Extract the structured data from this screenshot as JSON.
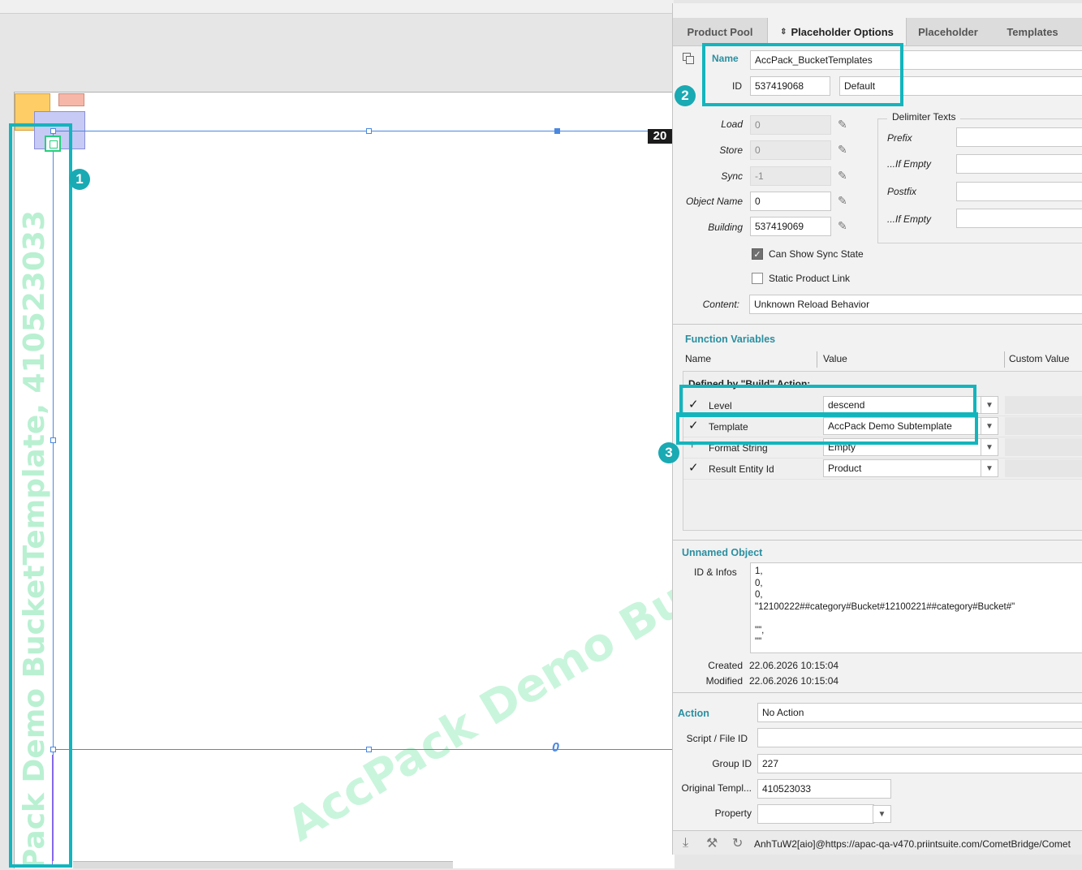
{
  "canvas": {
    "frame_counter": "20",
    "zero_marker": "0",
    "watermark_vertical": "Pack Demo BucketTemplate, 410523033",
    "watermark_diagonal": "AccPack Demo BucketT",
    "annotations": [
      "1",
      "2",
      "3"
    ]
  },
  "tabs": [
    {
      "label": "Product Pool"
    },
    {
      "label": "Placeholder Options",
      "prefix_icon": "sort-arrows-icon",
      "active": true
    },
    {
      "label": "Placeholder"
    },
    {
      "label": "Templates"
    }
  ],
  "header": {
    "name_label": "Name",
    "name_value": "AccPack_BucketTemplates",
    "id_label": "ID",
    "id_value": "537419068",
    "id_type": "Default"
  },
  "fields": {
    "load_label": "Load",
    "load_value": "0",
    "store_label": "Store",
    "store_value": "0",
    "sync_label": "Sync",
    "sync_value": "-1",
    "objname_label": "Object Name",
    "objname_value": "0",
    "building_label": "Building",
    "building_value": "537419069"
  },
  "delimiter": {
    "title": "Delimiter Texts",
    "prefix_label": "Prefix",
    "if_empty_label": "...If Empty",
    "postfix_label": "Postfix",
    "if_empty2_label": "...If Empty"
  },
  "checkboxes": {
    "sync_state_label": "Can Show Sync State",
    "sync_state_checked": true,
    "static_link_label": "Static Product Link",
    "static_link_checked": false
  },
  "content": {
    "label": "Content:",
    "value": "Unknown Reload Behavior"
  },
  "function_vars": {
    "title": "Function Variables",
    "col_name": "Name",
    "col_value": "Value",
    "col_custom": "Custom Value",
    "group_label": "Defined by \"Build\" Action:",
    "rows": [
      {
        "mark": "✓",
        "name": "Level",
        "value": "descend"
      },
      {
        "mark": "✓",
        "name": "Template",
        "value": "AccPack Demo Subtemplate"
      },
      {
        "mark": "+",
        "name": "Format String",
        "value": "Empty"
      },
      {
        "mark": "✓",
        "name": "Result Entity Id",
        "value": "Product"
      }
    ]
  },
  "object": {
    "title": "Unnamed Object",
    "id_infos_label": "ID & Infos",
    "id_infos_value": "1,\n0,\n0,\n\"12100222##category#Bucket#12100221##category#Bucket#\"\n\n\"\",\n\"\"",
    "created_label": "Created",
    "created_value": "22.06.2026 10:15:04",
    "modified_label": "Modified",
    "modified_value": "22.06.2026 10:15:04"
  },
  "action": {
    "title": "Action",
    "action_value": "No Action",
    "script_label": "Script / File ID",
    "script_value": "",
    "group_label": "Group ID",
    "group_value": "227",
    "orig_label": "Original Templ...",
    "orig_value": "410523033",
    "property_label": "Property",
    "property_value": ""
  },
  "status": {
    "text": "AnhTuW2[aio]@https://apac-qa-v470.priintsuite.com/CometBridge/Comet"
  },
  "colors": {
    "accent": "#13b5bd",
    "section": "#2a8fa0",
    "guide": "#4a88e0",
    "watermark": "#c9f5dc"
  }
}
